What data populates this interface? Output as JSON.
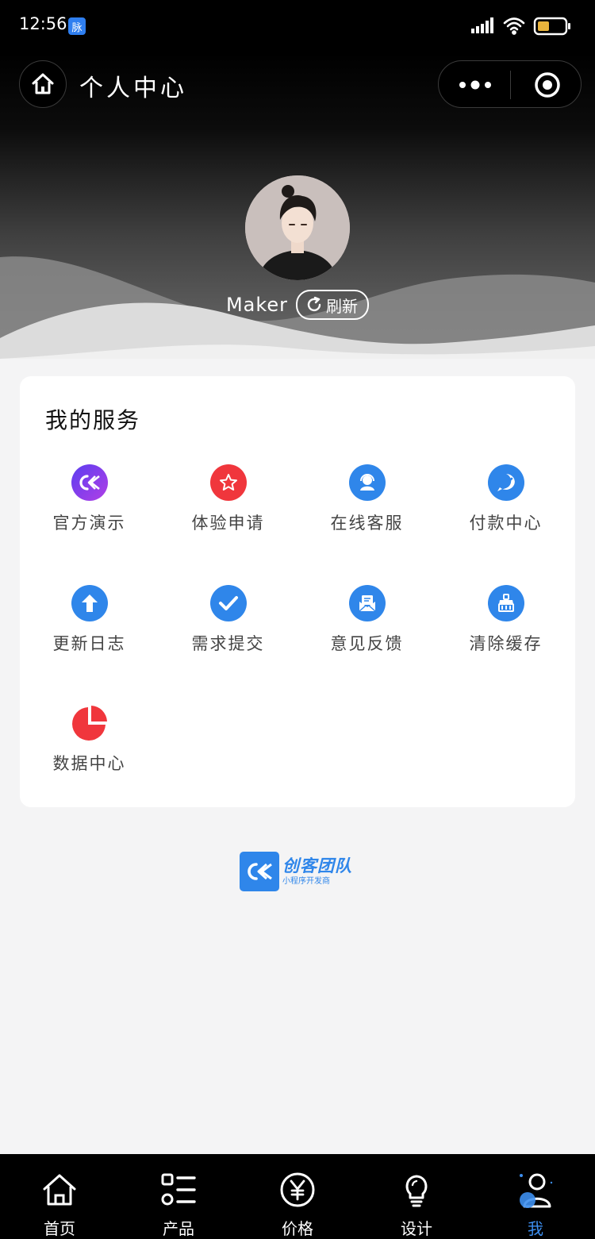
{
  "status_bar": {
    "time": "12:56",
    "app_badge": "脉"
  },
  "nav": {
    "title": "个人中心"
  },
  "profile": {
    "username": "Maker",
    "refresh_label": "刷新"
  },
  "services": {
    "title": "我的服务",
    "items": [
      {
        "label": "官方演示",
        "icon": "ck-logo-icon",
        "color": "#7b3ff2"
      },
      {
        "label": "体验申请",
        "icon": "star-icon",
        "color": "#f0363c"
      },
      {
        "label": "在线客服",
        "icon": "customer-service-icon",
        "color": "#2f86ea"
      },
      {
        "label": "付款中心",
        "icon": "payment-icon",
        "color": "#2f86ea"
      },
      {
        "label": "更新日志",
        "icon": "upload-arrow-icon",
        "color": "#2f86ea"
      },
      {
        "label": "需求提交",
        "icon": "checkmark-icon",
        "color": "#2f86ea"
      },
      {
        "label": "意见反馈",
        "icon": "feedback-mail-icon",
        "color": "#2f86ea"
      },
      {
        "label": "清除缓存",
        "icon": "clear-cache-icon",
        "color": "#2f86ea"
      },
      {
        "label": "数据中心",
        "icon": "pie-chart-icon",
        "color": "#f0363c"
      }
    ]
  },
  "brand": {
    "name": "创客团队",
    "subtitle": "小程序开发商"
  },
  "tabbar": {
    "items": [
      {
        "label": "首页",
        "icon": "home-icon"
      },
      {
        "label": "产品",
        "icon": "list-icon"
      },
      {
        "label": "价格",
        "icon": "yen-icon"
      },
      {
        "label": "设计",
        "icon": "lightbulb-icon"
      },
      {
        "label": "我",
        "icon": "user-icon",
        "active": true
      }
    ],
    "active_color": "#3d8ff0"
  }
}
